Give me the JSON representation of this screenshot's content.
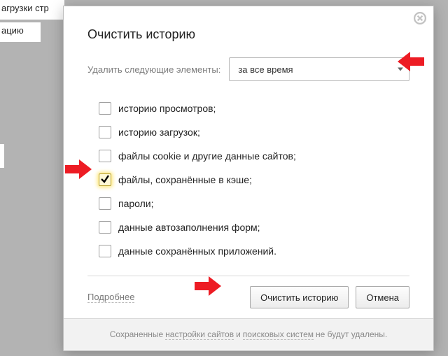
{
  "bg": {
    "line1": "агрузки стр",
    "line2": "ацию"
  },
  "dialog": {
    "title": "Очистить историю",
    "range": {
      "label": "Удалить следующие элементы:",
      "value": "за все время"
    },
    "items": [
      {
        "label": "историю просмотров;",
        "checked": false
      },
      {
        "label": "историю загрузок;",
        "checked": false
      },
      {
        "label": "файлы cookie и другие данные сайтов;",
        "checked": false
      },
      {
        "label": "файлы, сохранённые в кэше;",
        "checked": true
      },
      {
        "label": "пароли;",
        "checked": false
      },
      {
        "label": "данные автозаполнения форм;",
        "checked": false
      },
      {
        "label": "данные сохранённых приложений.",
        "checked": false
      }
    ],
    "more_label": "Подробнее",
    "clear_label": "Очистить историю",
    "cancel_label": "Отмена",
    "footer": {
      "pre": "Сохраненные ",
      "link1": "настройки сайтов",
      "mid": " и ",
      "link2": "поисковых систем",
      "post": " не будут удалены."
    }
  }
}
